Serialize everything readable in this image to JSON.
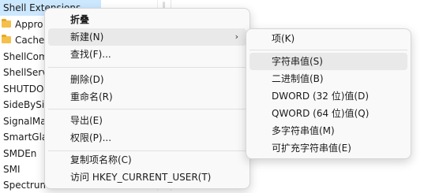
{
  "tree": {
    "items": [
      {
        "label": "Shell Extensions",
        "type": "plain",
        "selected": true
      },
      {
        "label": "Appro",
        "type": "folder"
      },
      {
        "label": "Cache",
        "type": "folder"
      },
      {
        "label": "ShellCom",
        "type": "plain"
      },
      {
        "label": "ShellServ",
        "type": "plain"
      },
      {
        "label": "SHUTDO",
        "type": "plain"
      },
      {
        "label": "SideBySi",
        "type": "plain"
      },
      {
        "label": "SignalMa",
        "type": "plain"
      },
      {
        "label": "SmartGla",
        "type": "plain"
      },
      {
        "label": "SMDEn",
        "type": "plain"
      },
      {
        "label": "SMI",
        "type": "plain"
      },
      {
        "label": "Spectrum",
        "type": "plain"
      }
    ]
  },
  "context_menu": {
    "collapse": "折叠",
    "new": "新建(N)",
    "find": "查找(F)...",
    "delete": "删除(D)",
    "rename": "重命名(R)",
    "export": "导出(E)",
    "permissions": "权限(P)...",
    "copy_key_name": "复制项名称(C)",
    "visit_hkcu": "访问 HKEY_CURRENT_USER(T)",
    "arrow": "›"
  },
  "submenu": {
    "key": "项(K)",
    "string_value": "字符串值(S)",
    "binary_value": "二进制值(B)",
    "dword_value": "DWORD (32 位)值(D)",
    "qword_value": "QWORD (64 位)值(Q)",
    "multi_string_value": "多字符串值(M)",
    "expandable_string_value": "可扩充字符串值(E)"
  }
}
